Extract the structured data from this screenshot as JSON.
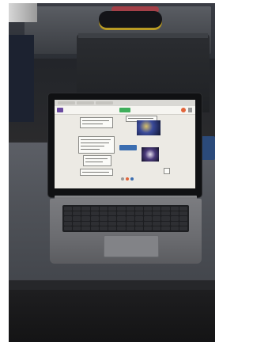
{
  "scene": {
    "description_visible_text": "",
    "colors": {
      "screen": "#eceae4",
      "app_accent": "#6a4aa0",
      "start_button": "#3fae5b",
      "record_button": "#e2643a"
    },
    "icons": [
      "app-logo-icon",
      "play-button-icon",
      "record-icon"
    ]
  }
}
